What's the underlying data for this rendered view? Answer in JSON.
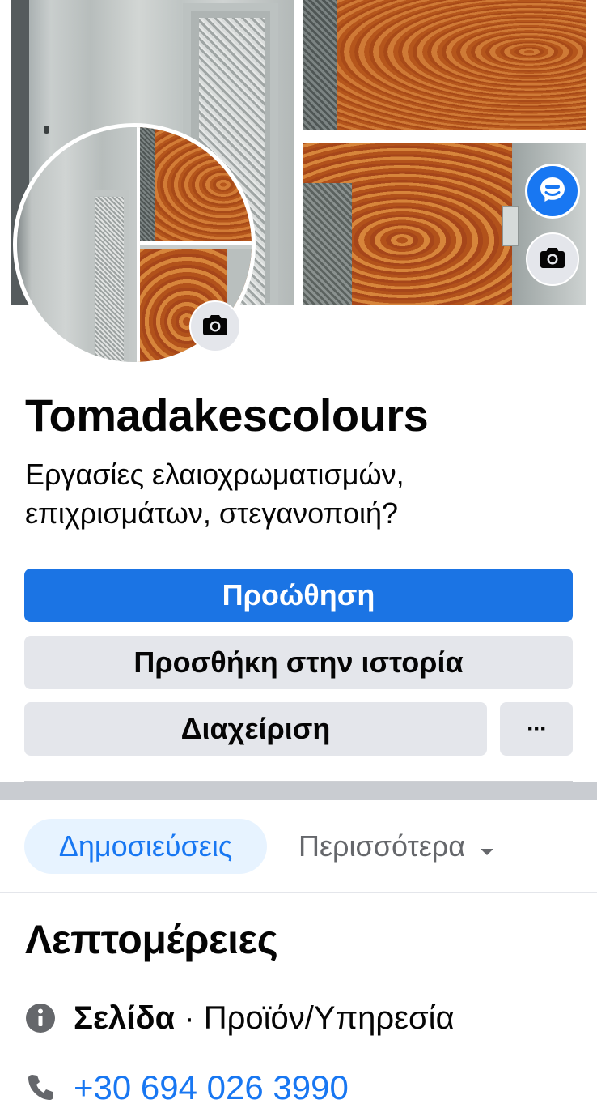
{
  "page": {
    "name": "Tomadakescolours",
    "description": "Εργασίες ελαιοχρωματισμών, επιχρισμάτων, στεγανοποιή?"
  },
  "buttons": {
    "promote": "Προώθηση",
    "add_to_story": "Προσθήκη στην ιστορία",
    "manage": "Διαχείριση",
    "more": "···"
  },
  "tabs": {
    "posts": "Δημοσιεύσεις",
    "more": "Περισσότερα"
  },
  "details": {
    "title": "Λεπτομέρειες",
    "category_label": "Σελίδα",
    "category_sep": " · ",
    "category_value": "Προϊόν/Υπηρεσία",
    "phone": "+30 694 026 3990"
  },
  "icons": {
    "cover_camera": "camera-icon",
    "avatar_camera": "camera-icon",
    "messenger": "messenger-icon",
    "info": "info-icon",
    "phone": "phone-icon",
    "dropdown": "caret-down-icon"
  },
  "colors": {
    "primary": "#1b74e4",
    "link": "#1877f2",
    "secondary_button": "#e4e6eb",
    "active_tab_bg": "#e7f3ff",
    "muted_text": "#65676b"
  }
}
